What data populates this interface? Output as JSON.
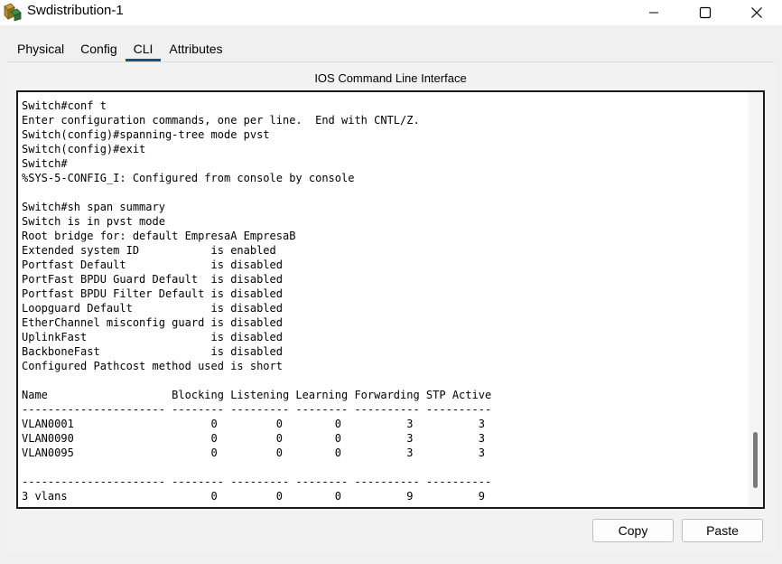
{
  "window": {
    "title": "Swdistribution-1",
    "icon": "packet-tracer-switch-icon"
  },
  "titlebar_buttons": {
    "minimize": "—",
    "maximize": "☐",
    "close": "✕"
  },
  "tabs": [
    {
      "label": "Physical",
      "active": false
    },
    {
      "label": "Config",
      "active": false
    },
    {
      "label": "CLI",
      "active": true
    },
    {
      "label": "Attributes",
      "active": false
    }
  ],
  "panel": {
    "title": "IOS Command Line Interface"
  },
  "console": {
    "text": "Switch#conf t\nEnter configuration commands, one per line.  End with CNTL/Z.\nSwitch(config)#spanning-tree mode pvst\nSwitch(config)#exit\nSwitch#\n%SYS-5-CONFIG_I: Configured from console by console\n\nSwitch#sh span summary\nSwitch is in pvst mode\nRoot bridge for: default EmpresaA EmpresaB\nExtended system ID           is enabled\nPortfast Default             is disabled\nPortFast BPDU Guard Default  is disabled\nPortfast BPDU Filter Default is disabled\nLoopguard Default            is disabled\nEtherChannel misconfig guard is disabled\nUplinkFast                   is disabled\nBackboneFast                 is disabled\nConfigured Pathcost method used is short\n\nName                   Blocking Listening Learning Forwarding STP Active\n---------------------- -------- --------- -------- ---------- ----------\nVLAN0001                     0         0        0          3          3\nVLAN0090                     0         0        0          3          3\nVLAN0095                     0         0        0          3          3\n\n---------------------- -------- --------- -------- ---------- ----------\n3 vlans                      0         0        0          9          9"
  },
  "buttons": {
    "copy": "Copy",
    "paste": "Paste"
  }
}
